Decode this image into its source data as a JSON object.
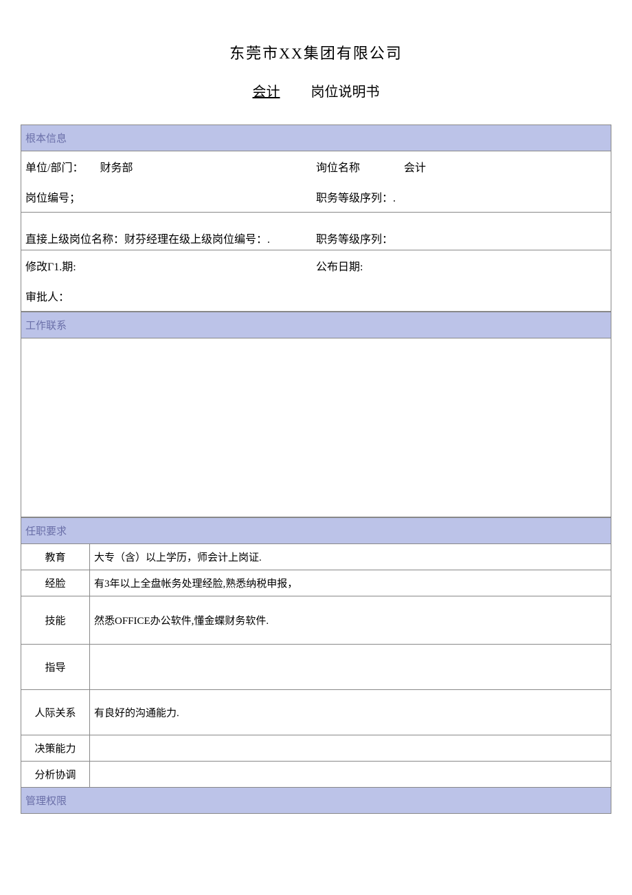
{
  "header": {
    "company": "东莞市XX集团有限公司",
    "position_underlined": "会计",
    "doc_type": "岗位说明书"
  },
  "sections": {
    "basic_info": {
      "title": "根本信息",
      "rows": {
        "dept_label": "单位/部门：",
        "dept_value": "财务部",
        "pos_name_label": "询位名称",
        "pos_name_value": "会计",
        "pos_no_label": "岗位编号；",
        "rank_seq_label": "职务等级序列：.",
        "superior_label": "直接上级岗位名称：财芬经理在级上级岗位编号：.",
        "rank_seq_label2": "职务等级序列：",
        "modify_label": "修改Γ1.期:",
        "publish_label": "公布日期:",
        "approver_label": "审批人："
      }
    },
    "work_contact": {
      "title": "工作联系"
    },
    "requirements": {
      "title": "任职要求",
      "items": [
        {
          "label": "教育",
          "value": "大专（含）以上学历，师会计上岗证."
        },
        {
          "label": "经脸",
          "value": "有3年以上全盘帐务处理经脸,熟悉纳税申报，"
        },
        {
          "label": "技能",
          "value": "然悉OFFICE办公软件,懂金蝶财务软件."
        },
        {
          "label": "指导",
          "value": ""
        },
        {
          "label": "人际关系",
          "value": "有良好的沟通能力."
        },
        {
          "label": "决策能力",
          "value": ""
        },
        {
          "label": "分析协调",
          "value": ""
        }
      ]
    },
    "mgmt": {
      "title": "管理权限"
    }
  }
}
